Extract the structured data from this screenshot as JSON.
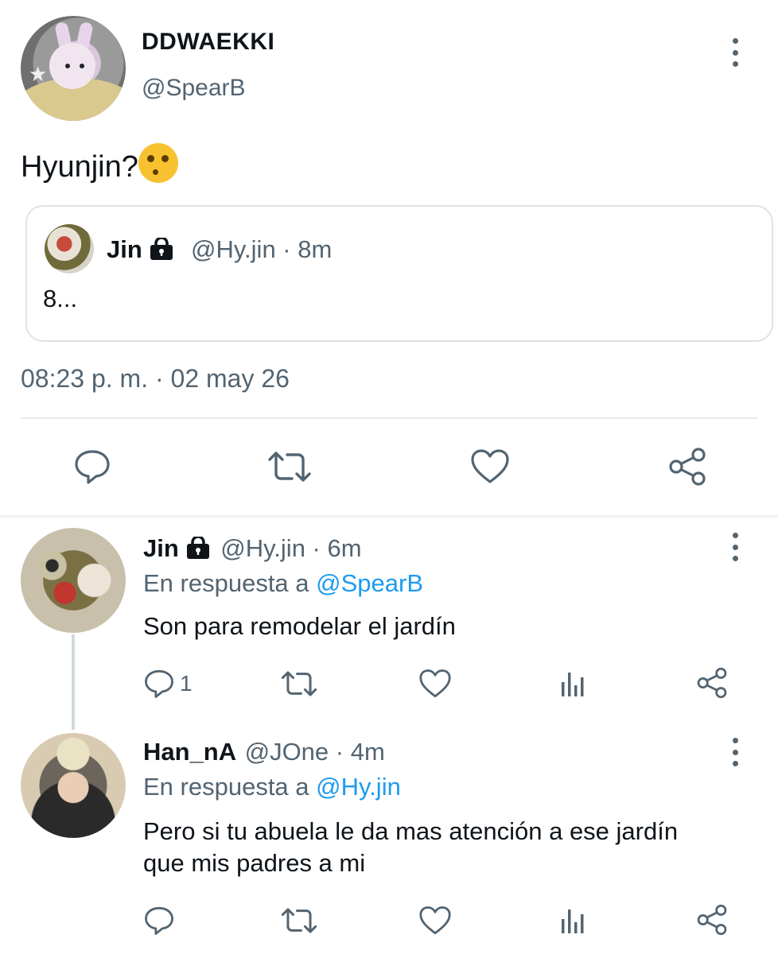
{
  "main_tweet": {
    "display_name": "DDWAEKKI",
    "handle": "@SpearB",
    "text": "Hyunjin?",
    "emoji": "face-with-raised-eyebrow",
    "timestamp": "08:23 p. m. · 02 may 26"
  },
  "quoted_tweet": {
    "display_name": "Jin",
    "locked": true,
    "meta": "@Hy.jin · 8m",
    "text": "8..."
  },
  "main_actions": {
    "icons": [
      "reply-icon",
      "retweet-icon",
      "like-icon",
      "share-icon"
    ]
  },
  "replies": [
    {
      "display_name": "Jin",
      "locked": true,
      "meta": "@Hy.jin · 6m",
      "reply_prefix": "En respuesta a ",
      "reply_to": "@SpearB",
      "text": "Son para remodelar el jardín",
      "reply_count": "1"
    },
    {
      "display_name": "Han_nA",
      "locked": false,
      "meta": "@JOne · 4m",
      "reply_prefix": "En respuesta a ",
      "reply_to": "@Hy.jin",
      "text_line1": "Pero si tu abuela le da mas atención a ese jardín",
      "text_line2": "que mis padres a mi",
      "reply_count": ""
    }
  ],
  "colors": {
    "text": "#0f1419",
    "secondary": "#536471",
    "link": "#1d9bf0",
    "divider": "#e6e9eb"
  }
}
